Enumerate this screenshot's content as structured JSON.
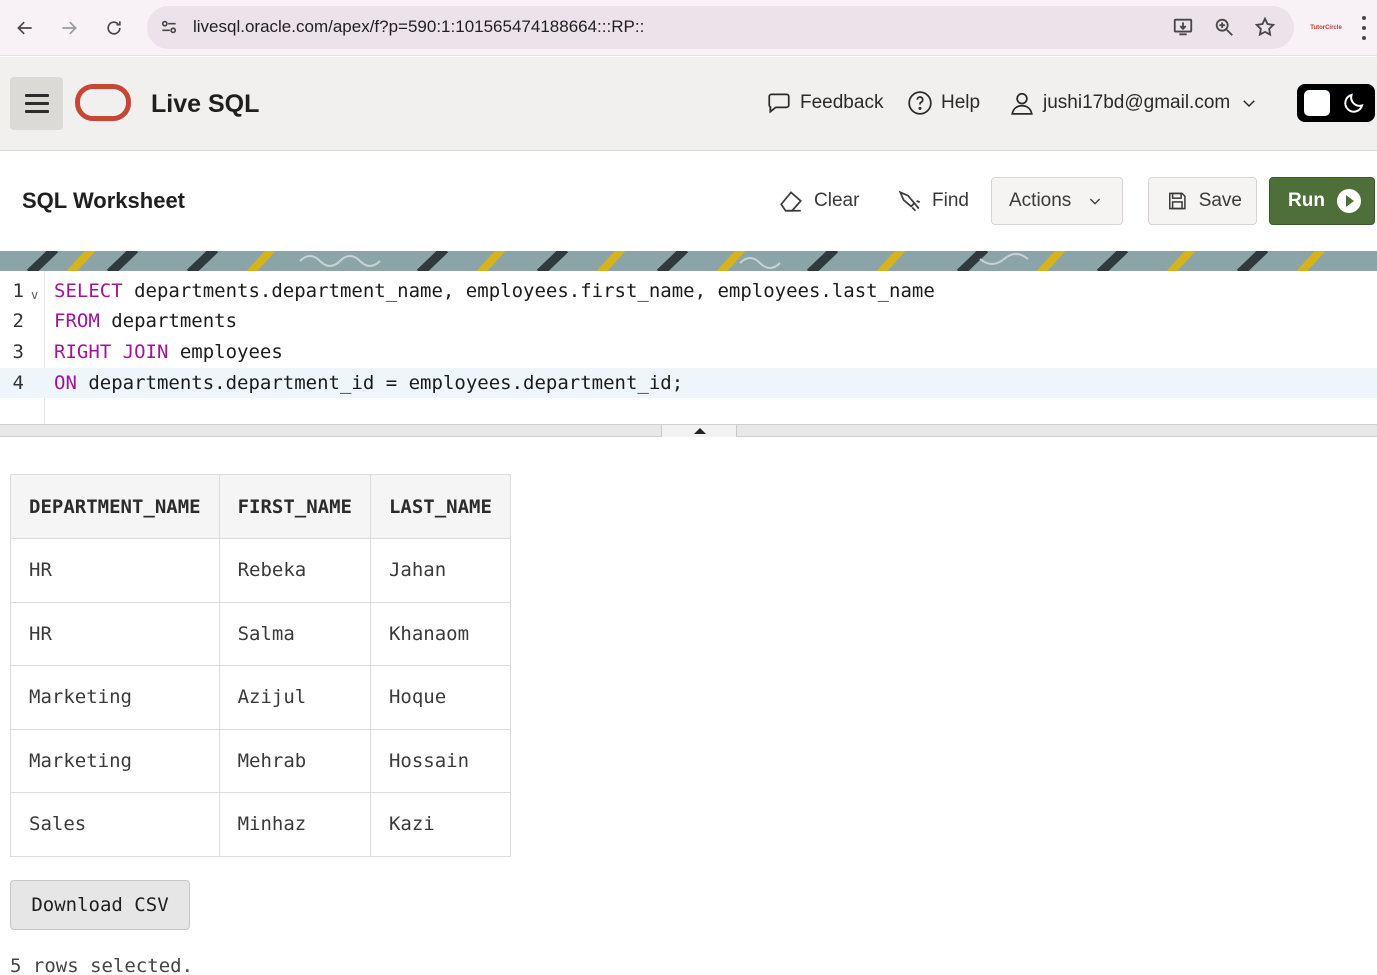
{
  "browser": {
    "url": "livesql.oracle.com/apex/f?p=590:1:101565474188664:::RP::",
    "profile_text": "TutorCircle"
  },
  "header": {
    "app_title": "Live SQL",
    "feedback_label": "Feedback",
    "help_label": "Help",
    "user_email": "jushi17bd@gmail.com"
  },
  "worksheet": {
    "title": "SQL Worksheet",
    "clear_label": "Clear",
    "find_label": "Find",
    "actions_label": "Actions",
    "save_label": "Save",
    "run_label": "Run"
  },
  "editor": {
    "lines": [
      {
        "num": "1",
        "keyword": "SELECT",
        "rest": " departments.department_name, employees.first_name, employees.last_name"
      },
      {
        "num": "2",
        "keyword": "FROM",
        "rest": " departments"
      },
      {
        "num": "3",
        "keyword": "RIGHT JOIN",
        "rest": " employees"
      },
      {
        "num": "4",
        "keyword": "ON",
        "rest": " departments.department_id = employees.department_id;"
      }
    ]
  },
  "results": {
    "columns": [
      "DEPARTMENT_NAME",
      "FIRST_NAME",
      "LAST_NAME"
    ],
    "rows": [
      [
        "HR",
        "Rebeka",
        "Jahan"
      ],
      [
        "HR",
        "Salma",
        "Khanaom"
      ],
      [
        "Marketing",
        "Azijul",
        "Hoque"
      ],
      [
        "Marketing",
        "Mehrab",
        "Hossain"
      ],
      [
        "Sales",
        "Minhaz",
        "Kazi"
      ]
    ],
    "download_label": "Download CSV",
    "status": "5 rows selected."
  },
  "colors": {
    "oracle_red": "#c74634",
    "run_green": "#4e6e3a",
    "keyword_purple": "#a0139b"
  }
}
